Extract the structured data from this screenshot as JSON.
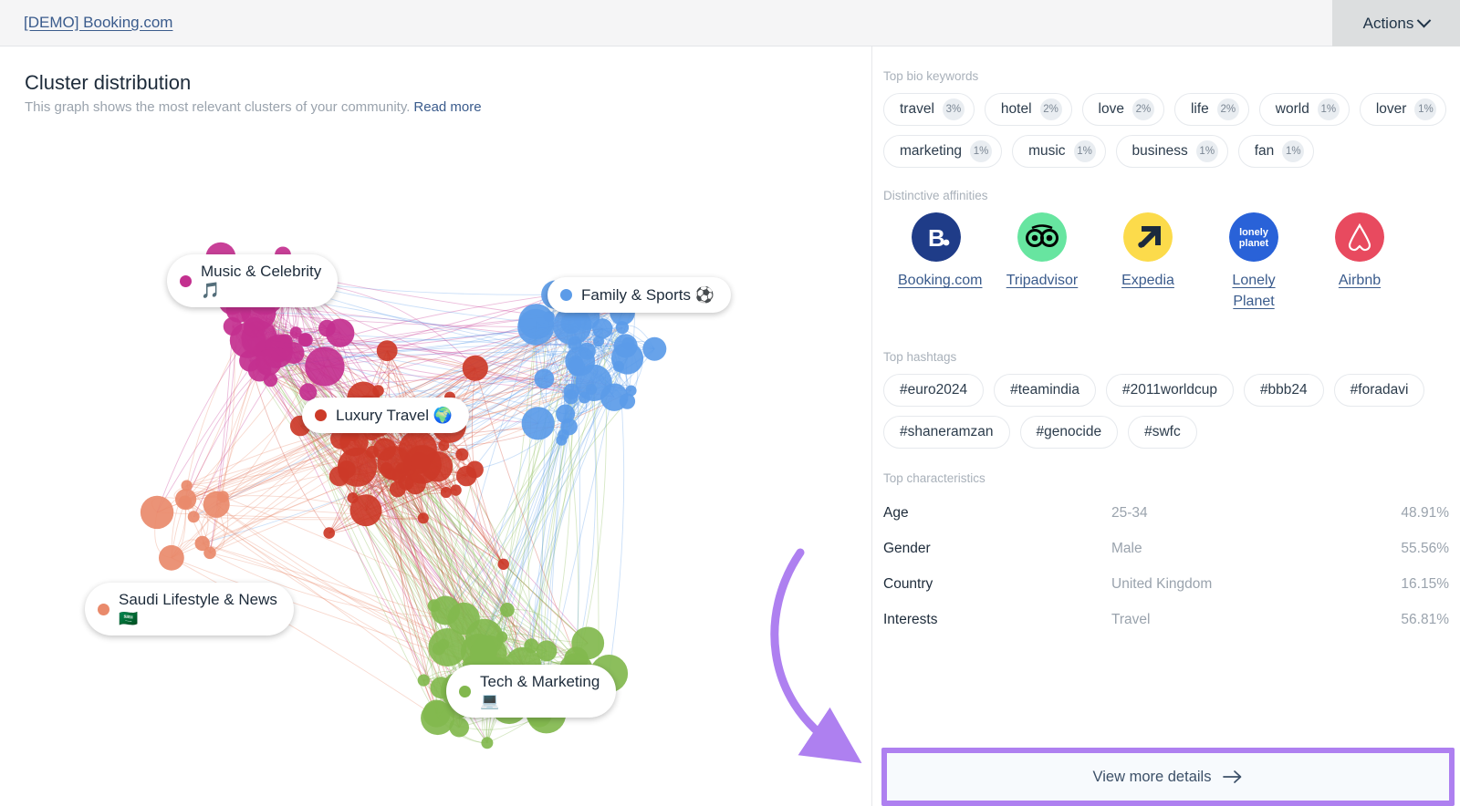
{
  "topbar": {
    "title": "[DEMO] Booking.com",
    "actions_label": "Actions",
    "chevron_icon": "chevron-down-icon"
  },
  "left_panel": {
    "title": "Cluster distribution",
    "subtitle": "This graph shows the most relevant clusters of your community.",
    "read_more": "Read more"
  },
  "clusters": [
    {
      "label": "Music & Celebrity",
      "emoji": "🎵",
      "color": "#C3308F"
    },
    {
      "label": "Family & Sports",
      "emoji": "⚽",
      "color": "#5B9BE8"
    },
    {
      "label": "Luxury Travel",
      "emoji": "🌍",
      "color": "#CC3A28"
    },
    {
      "label": "Saudi Lifestyle & News",
      "emoji": "🇸🇦",
      "color": "#E98A6B"
    },
    {
      "label": "Tech & Marketing",
      "emoji": "💻",
      "color": "#82B84E"
    }
  ],
  "bio_keywords": {
    "section_label": "Top bio keywords",
    "items": [
      {
        "word": "travel",
        "pct": "3%"
      },
      {
        "word": "hotel",
        "pct": "2%"
      },
      {
        "word": "love",
        "pct": "2%"
      },
      {
        "word": "life",
        "pct": "2%"
      },
      {
        "word": "world",
        "pct": "1%"
      },
      {
        "word": "lover",
        "pct": "1%"
      },
      {
        "word": "marketing",
        "pct": "1%"
      },
      {
        "word": "music",
        "pct": "1%"
      },
      {
        "word": "business",
        "pct": "1%"
      },
      {
        "word": "fan",
        "pct": "1%"
      }
    ]
  },
  "affinities": {
    "section_label": "Distinctive affinities",
    "items": [
      {
        "name": "Booking.com",
        "logo": "booking-logo-icon",
        "bg": "#1F3C88",
        "fg": "#ffffff"
      },
      {
        "name": "Tripadvisor",
        "logo": "tripadvisor-owl-icon",
        "bg": "#67E5A0",
        "fg": "#000000"
      },
      {
        "name": "Expedia",
        "logo": "expedia-arrow-icon",
        "bg": "#FCDB4B",
        "fg": "#1B2A3D"
      },
      {
        "name": "Lonely Planet",
        "logo": "lonely-planet-logo-icon",
        "bg": "#2962D8",
        "fg": "#ffffff"
      },
      {
        "name": "Airbnb",
        "logo": "airbnb-logo-icon",
        "bg": "#E84A5F",
        "fg": "#ffffff"
      }
    ]
  },
  "hashtags": {
    "section_label": "Top hashtags",
    "items": [
      "#euro2024",
      "#teamindia",
      "#2011worldcup",
      "#bbb24",
      "#foradavi",
      "#shaneramzan",
      "#genocide",
      "#swfc"
    ]
  },
  "characteristics": {
    "section_label": "Top characteristics",
    "rows": [
      {
        "key": "Age",
        "value": "25-34",
        "pct": "48.91%"
      },
      {
        "key": "Gender",
        "value": "Male",
        "pct": "55.56%"
      },
      {
        "key": "Country",
        "value": "United Kingdom",
        "pct": "16.15%"
      },
      {
        "key": "Interests",
        "value": "Travel",
        "pct": "56.81%"
      }
    ]
  },
  "footer": {
    "view_more_label": "View more details",
    "arrow_icon": "arrow-right-icon",
    "highlight_color": "#AE80F0"
  },
  "chart_data": {
    "type": "scatter",
    "title": "Cluster distribution",
    "subtitle": "This graph shows the most relevant clusters of your community.",
    "description": "Force-directed network graph of community members grouped into 5 colored clusters; node size encodes influence, edges encode connections.",
    "grid": false,
    "legend": "inline-labels",
    "series": [
      {
        "name": "Music & Celebrity",
        "color": "#C3308F",
        "node_count": 34,
        "region": "upper-left"
      },
      {
        "name": "Family & Sports",
        "color": "#5B9BE8",
        "node_count": 38,
        "region": "upper-right"
      },
      {
        "name": "Luxury Travel",
        "color": "#CC3A28",
        "node_count": 52,
        "region": "center"
      },
      {
        "name": "Saudi Lifestyle & News",
        "color": "#E98A6B",
        "node_count": 10,
        "region": "lower-left"
      },
      {
        "name": "Tech & Marketing",
        "color": "#82B84E",
        "node_count": 46,
        "region": "lower-right"
      }
    ]
  }
}
